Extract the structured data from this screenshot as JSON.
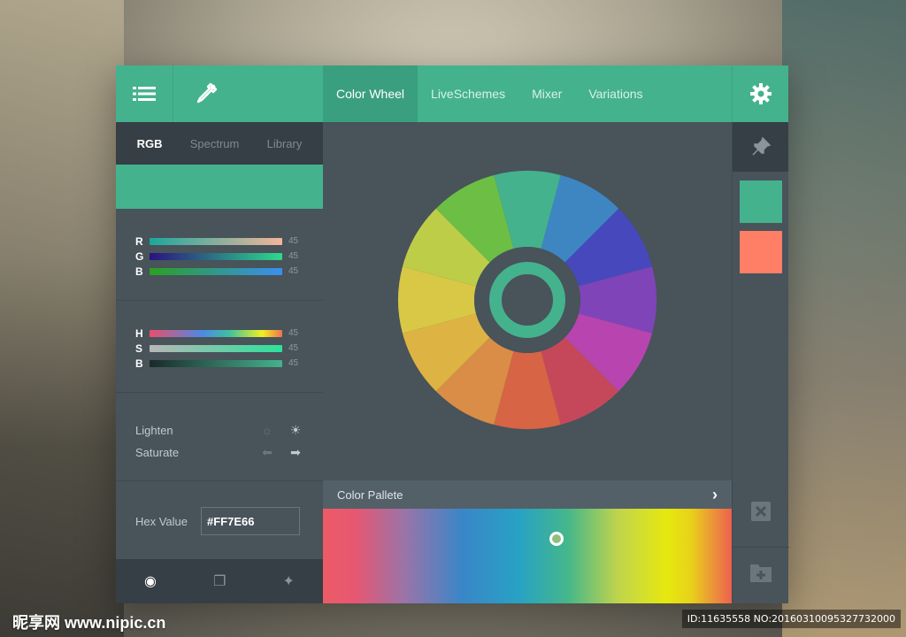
{
  "topbar": {
    "tabs": [
      {
        "label": "Color Wheel",
        "active": true
      },
      {
        "label": "LiveSchemes",
        "active": false
      },
      {
        "label": "Mixer",
        "active": false
      },
      {
        "label": "Variations",
        "active": false
      }
    ],
    "icons": [
      "menu-icon",
      "eyedropper-icon",
      "gear-icon"
    ]
  },
  "left_panel": {
    "subtabs": [
      {
        "label": "RGB",
        "active": true
      },
      {
        "label": "Spectrum",
        "active": false
      },
      {
        "label": "Library",
        "active": false
      }
    ],
    "current_color": "#44b28d",
    "rgb": [
      {
        "label": "R",
        "value": "45"
      },
      {
        "label": "G",
        "value": "45"
      },
      {
        "label": "B",
        "value": "45"
      }
    ],
    "hsb": [
      {
        "label": "H",
        "value": "45"
      },
      {
        "label": "S",
        "value": "45"
      },
      {
        "label": "B",
        "value": "45"
      }
    ],
    "lighten_label": "Lighten",
    "saturate_label": "Saturate",
    "hex_label": "Hex Value",
    "hex_value": "#FF7E66"
  },
  "wheel": {
    "segments": [
      "#44b28d",
      "#3e86c2",
      "#4748bb",
      "#7f44b8",
      "#b844b0",
      "#c5485a",
      "#d66445",
      "#d98d46",
      "#ddb344",
      "#d8c845",
      "#bdcd48",
      "#6dbe45"
    ]
  },
  "pallete": {
    "label": "Color Pallete",
    "selected_position": 0.57
  },
  "right_strip": {
    "swatches": [
      "#44b28d",
      "#ff7e66"
    ]
  },
  "watermark": {
    "left": "昵享网 www.nipic.cn",
    "right": "ID:11635558 NO:20160310095327732000"
  },
  "colors": {
    "accent": "#44b28d",
    "panel": "#48535a",
    "dark": "#353f45"
  }
}
